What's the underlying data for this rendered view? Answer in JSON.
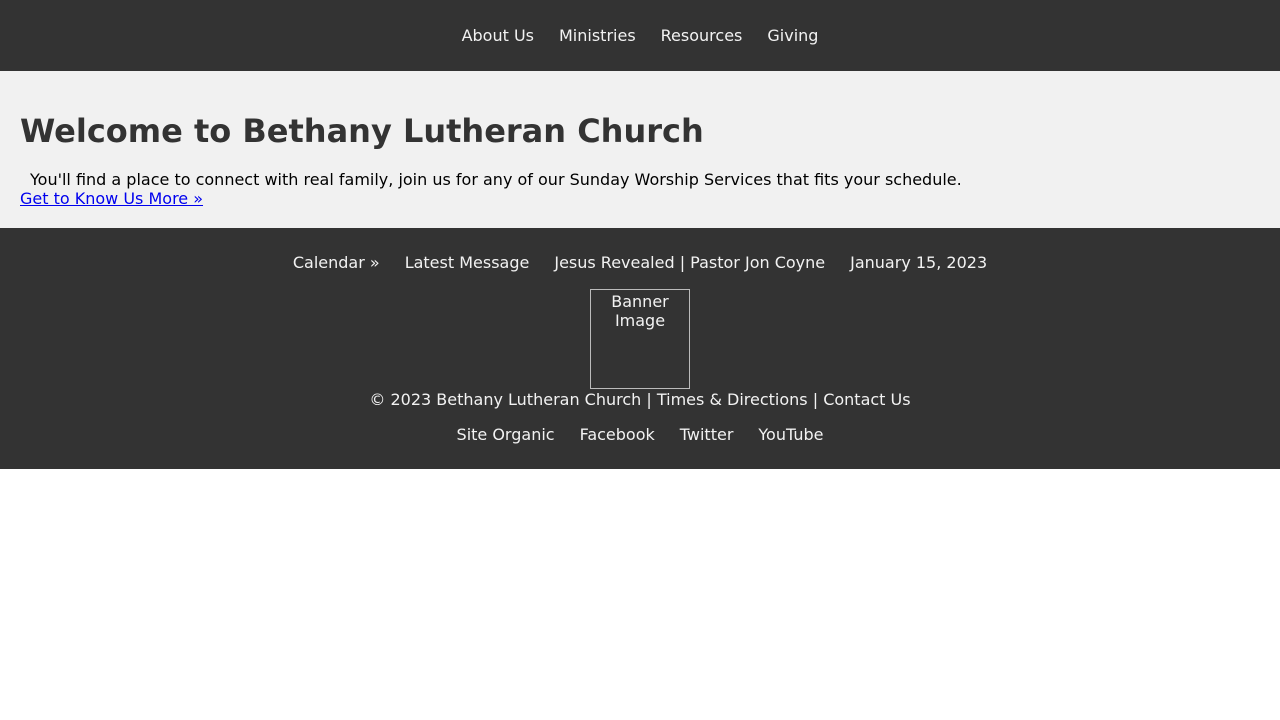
{
  "nav": {
    "items": [
      {
        "label": "About Us"
      },
      {
        "label": "Ministries"
      },
      {
        "label": "Resources"
      },
      {
        "label": "Giving"
      }
    ]
  },
  "hero": {
    "title": "Welcome to Bethany Lutheran Church",
    "text": "You'll find a place to connect with real family, join us for any of our Sunday Worship Services that fits your schedule.",
    "link": "Get to Know Us More »"
  },
  "footer": {
    "links": [
      {
        "label": "Calendar »"
      },
      {
        "label": "Latest Message"
      },
      {
        "label": "Jesus Revealed | Pastor Jon Coyne"
      },
      {
        "label": "January 15, 2023"
      }
    ],
    "banner_alt": "Banner Image",
    "copyright_prefix": "© 2023 Bethany Lutheran Church | ",
    "times_link": "Times & Directions",
    "separator": " | ",
    "contact_link": "Contact Us",
    "social": [
      {
        "label": "Site Organic"
      },
      {
        "label": "Facebook"
      },
      {
        "label": "Twitter"
      },
      {
        "label": "YouTube"
      }
    ]
  }
}
